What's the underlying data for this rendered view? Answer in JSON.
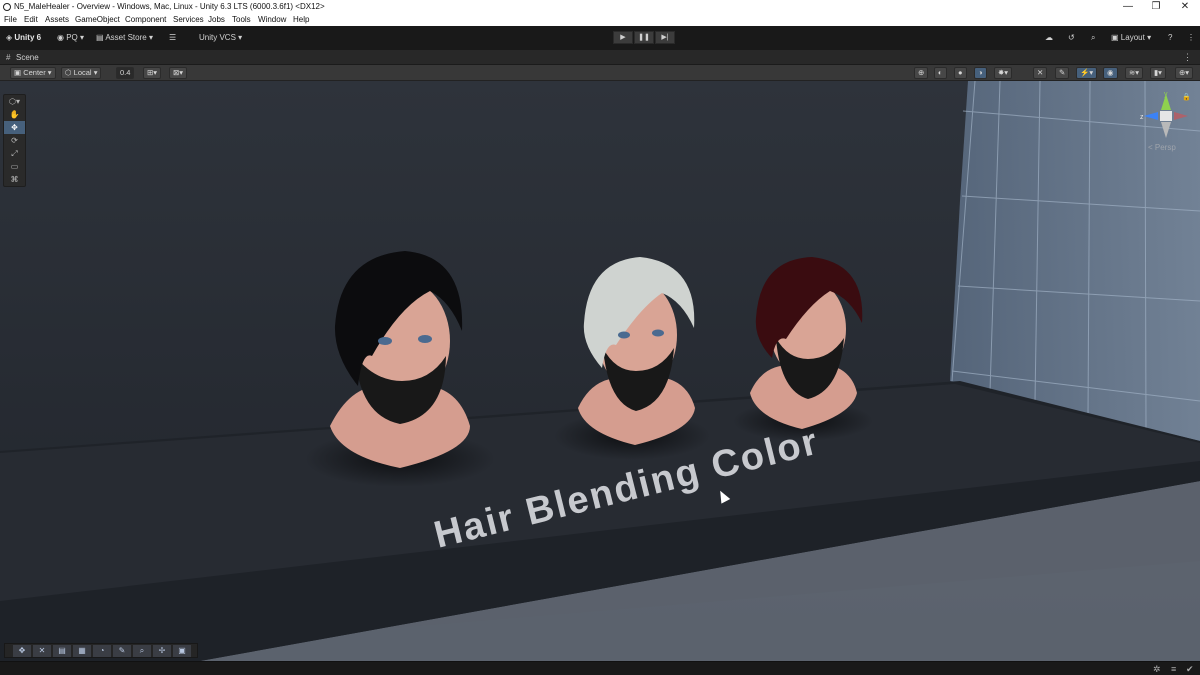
{
  "window": {
    "title": "N5_MaleHealer - Overview - Windows, Mac, Linux - Unity 6.3 LTS (6000.3.6f1) <DX12>",
    "minimize": "—",
    "maximize": "❐",
    "close": "✕"
  },
  "menu": [
    "File",
    "Edit",
    "Assets",
    "GameObject",
    "Component",
    "Services",
    "Jobs",
    "Tools",
    "Window",
    "Help"
  ],
  "toolbar": {
    "unity_label": "Unity 6",
    "account": "PQ",
    "asset_store": "Asset Store",
    "vcs": "Unity VCS",
    "layout": "Layout",
    "help": "?"
  },
  "scene_tab": {
    "label": "Scene"
  },
  "scene_toolbar": {
    "pivot": "Center",
    "space": "Local",
    "snap_value": "0.4"
  },
  "viewport": {
    "floor_text": "Hair Blending Color",
    "projection": "< Persp",
    "axis_y": "y",
    "axis_z": "z"
  },
  "heads": [
    {
      "hair_color": "#0c0c0e"
    },
    {
      "hair_color": "#cfd3d0"
    },
    {
      "hair_color": "#3a0c10"
    }
  ],
  "colors": {
    "accent": "#46607c",
    "axis_y": "#8fd14f",
    "axis_z": "#3b82f6",
    "axis_x": "#e04848"
  }
}
